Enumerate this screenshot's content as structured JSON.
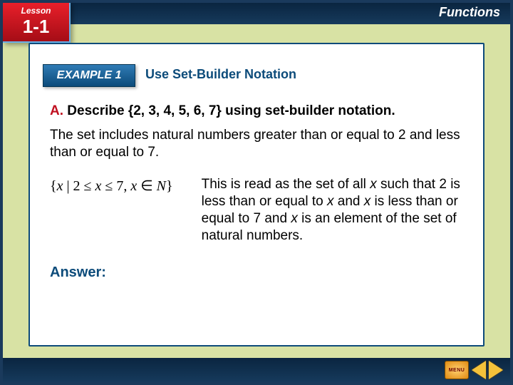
{
  "lesson": {
    "label": "Lesson",
    "number": "1-1"
  },
  "topic": "Functions",
  "example": {
    "tab": "EXAMPLE 1",
    "title": "Use Set-Builder Notation"
  },
  "prompt": {
    "letter": "A.",
    "text": " Describe {2, 3, 4, 5, 6, 7} using set-builder notation."
  },
  "desc": "The set includes natural numbers greater than or equal to 2 and less than or equal to 7.",
  "set_notation": "{ x | 2 ≤ x ≤ 7, x ∈ N }",
  "explain_prefix": "This is read as the set of all ",
  "explain_mid1": " such that 2 is less than or equal to ",
  "explain_mid2": " and ",
  "explain_mid3": " is less than or equal to 7 and ",
  "explain_suffix": " is an element of the set of natural numbers.",
  "x": "x",
  "answer_label": "Answer:",
  "menu_label": "MENU"
}
